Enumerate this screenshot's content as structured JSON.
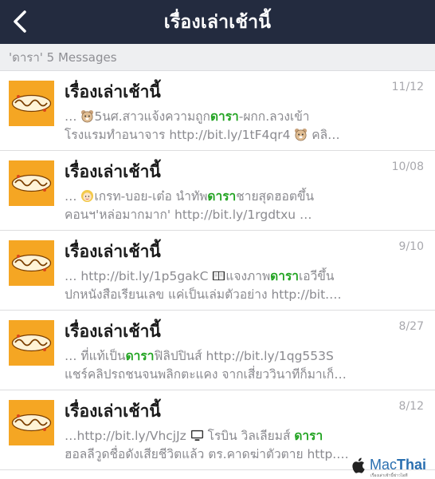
{
  "navbar": {
    "title": "เรื่องเล่าเช้านี้",
    "back_icon": "chevron-left-icon"
  },
  "search_header": "'ดารา' 5 Messages",
  "results": [
    {
      "title": "เรื่องเล่าเช้านี้",
      "date": "11/12",
      "line1_pre": "… ",
      "line1_emoji": "bear-emoji",
      "line1_mid": "5นศ.สาวแจ้งความถูก",
      "line1_hl": "ดารา",
      "line1_post": "-ผกก.ลวงเข้า",
      "line2_pre": "โรงแรมทำอนาจาร http://bit.ly/1tF4qr4 ",
      "line2_emoji": "bear-emoji",
      "line2_post": " คลิ…"
    },
    {
      "title": "เรื่องเล่าเช้านี้",
      "date": "10/08",
      "line1_pre": "… ",
      "line1_emoji": "girl-emoji",
      "line1_mid": "เกรท-บอย-เต๋อ นำทัพ",
      "line1_hl": "ดารา",
      "line1_post": "ชายสุดฮอตขึ้น",
      "line2_pre": "คอนฯ'หล่อมากมาก' http://bit.ly/1rgdtxu …",
      "line2_emoji": "",
      "line2_post": ""
    },
    {
      "title": "เรื่องเล่าเช้านี้",
      "date": "9/10",
      "line1_pre": "… http://bit.ly/1p5gakC ",
      "line1_emoji": "book-emoji",
      "line1_mid": "แจงภาพ",
      "line1_hl": "ดารา",
      "line1_post": "เอวีขึ้น",
      "line2_pre": "ปกหนังสือเรียนเลข แค่เป็นเล่มตัวอย่าง http://bit.…",
      "line2_emoji": "",
      "line2_post": ""
    },
    {
      "title": "เรื่องเล่าเช้านี้",
      "date": "8/27",
      "line1_pre": "… ที่แท้เป็น",
      "line1_emoji": "",
      "line1_mid": "",
      "line1_hl": "ดารา",
      "line1_post": "ฟิลิปปินส์ http://bit.ly/1qg553S",
      "line2_pre": "แชร์คลิปรถชนจนพลิกตะแคง จากเสี่ยววินาทีก็มาเก็…",
      "line2_emoji": "",
      "line2_post": ""
    },
    {
      "title": "เรื่องเล่าเช้านี้",
      "date": "8/12",
      "line1_pre": "…http://bit.ly/VhcjJz ",
      "line1_emoji": "tv-emoji",
      "line1_mid": " โรบิน วิลเลียมส์ ",
      "line1_hl": "ดารา",
      "line1_post": "",
      "line2_pre": "ฮอลลีวูดชื่อดังเสียชีวิตแล้ว ตร.คาดฆ่าตัวตาย http.…",
      "line2_emoji": "",
      "line2_post": ""
    }
  ],
  "watermark": {
    "brand_a": "Mac",
    "brand_b": "Thai",
    "tagline": "เรื่องเล่าเช้านี้ข่าวไอที"
  },
  "colors": {
    "navbar": "#232b3f",
    "highlight": "#21a321",
    "thumbnail": "#f5a623"
  }
}
